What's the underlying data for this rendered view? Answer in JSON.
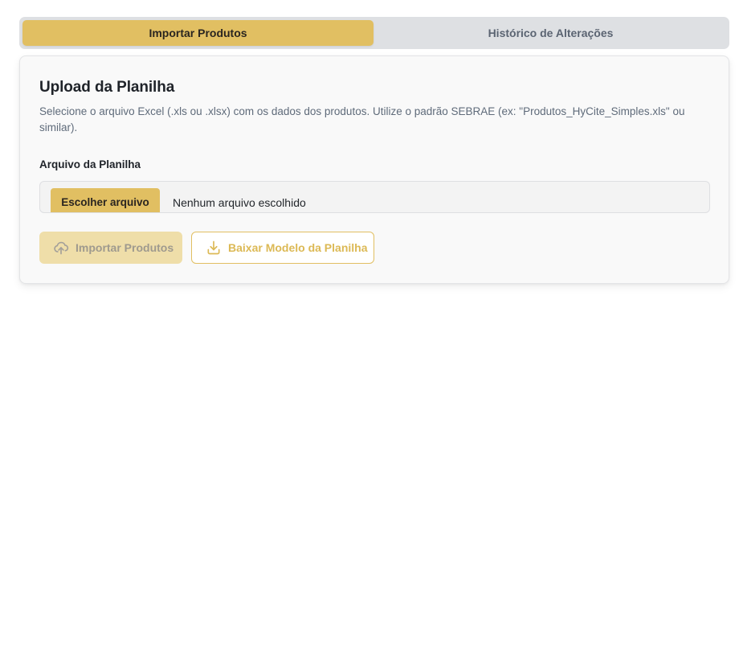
{
  "tabs": [
    {
      "label": "Importar Produtos",
      "active": true
    },
    {
      "label": "Histórico de Alterações",
      "active": false
    }
  ],
  "card": {
    "title": "Upload da Planilha",
    "description": "Selecione o arquivo Excel (.xls ou .xlsx) com os dados dos produtos. Utilize o padrão SEBRAE (ex: \"Produtos_HyCite_Simples.xls\" ou similar).",
    "field_label": "Arquivo da Planilha",
    "file_button_label": "Escolher arquivo",
    "file_status": "Nenhum arquivo escolhido",
    "import_button_label": "Importar Produtos",
    "import_button_icon": "cloud-upload-icon",
    "download_button_label": "Baixar Modelo da Planilha",
    "download_button_icon": "download-icon"
  },
  "colors": {
    "accent": "#e1bf62",
    "accent_disabled": "#efdea9",
    "tab_bar": "#dee0e3",
    "card_bg": "#f9f9f9"
  }
}
